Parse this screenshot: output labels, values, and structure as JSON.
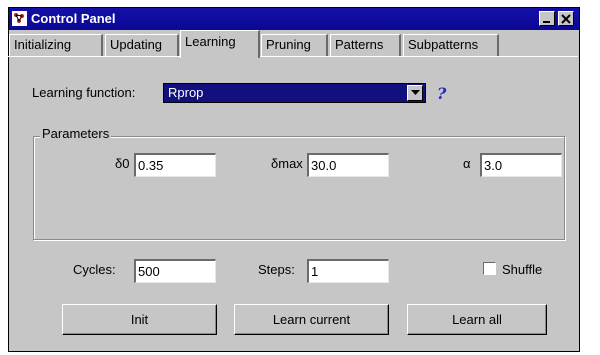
{
  "window": {
    "title": "Control Panel",
    "title_icon": "app-icon",
    "minimize_icon": "minimize-icon",
    "close_icon": "close-icon"
  },
  "tabs": [
    {
      "label": "Initializing",
      "selected": false
    },
    {
      "label": "Updating",
      "selected": false
    },
    {
      "label": "Learning",
      "selected": true
    },
    {
      "label": "Pruning",
      "selected": false
    },
    {
      "label": "Patterns",
      "selected": false
    },
    {
      "label": "Subpatterns",
      "selected": false
    }
  ],
  "learning_function": {
    "label": "Learning function:",
    "value": "Rprop",
    "help": "?"
  },
  "parameters": {
    "label": "Parameters",
    "fields": [
      {
        "label": "δ0",
        "value": "0.35"
      },
      {
        "label": "δmax",
        "value": "30.0"
      },
      {
        "label": "α",
        "value": "3.0"
      }
    ]
  },
  "cycles": {
    "label": "Cycles:",
    "value": "500"
  },
  "steps": {
    "label": "Steps:",
    "value": "1"
  },
  "shuffle": {
    "label": "Shuffle",
    "checked": false
  },
  "buttons": {
    "init": "Init",
    "learn_current": "Learn current",
    "learn_all": "Learn all"
  },
  "colors": {
    "titlebar": "#0a0894",
    "panel": "#c6c6c6",
    "selected_dropdown": "#12107e"
  }
}
